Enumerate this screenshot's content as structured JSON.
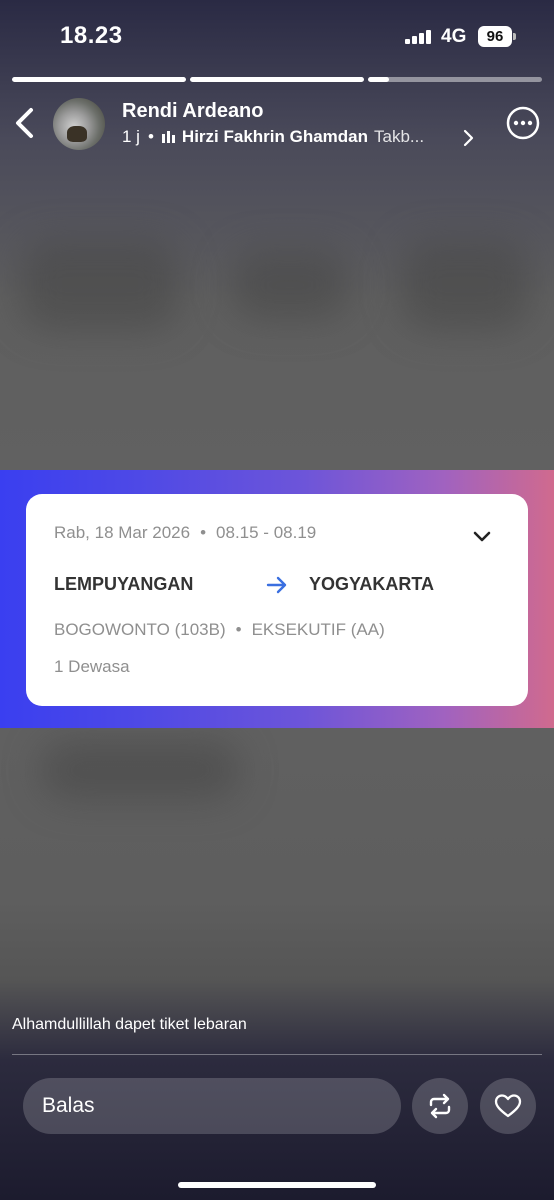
{
  "status_bar": {
    "time": "18.23",
    "network": "4G",
    "battery": "96"
  },
  "story_progress": [
    1.0,
    1.0,
    0.12
  ],
  "header": {
    "username": "Rendi Ardeano",
    "age": "1 j",
    "separator": "•",
    "song_artist": "Hirzi Fakhrin Ghamdan",
    "song_title_truncated": "Takb..."
  },
  "ticket": {
    "date": "Rab, 18 Mar 2026",
    "separator": "•",
    "time_range": "08.15 - 08.19",
    "origin": "LEMPUYANGAN",
    "destination": "YOGYAKARTA",
    "train": "BOGOWONTO (103B)",
    "class": "EKSEKUTIF (AA)",
    "passengers": "1 Dewasa"
  },
  "caption": "Alhamdullillah dapet tiket lebaran",
  "reply": {
    "placeholder": "Balas"
  },
  "colors": {
    "accent_arrow": "#3a6fe0",
    "band_left": "#3a3ff0",
    "band_right": "#d06a8e"
  },
  "icons": [
    "back-icon",
    "audio-bars-icon",
    "chevron-right-icon",
    "more-icon",
    "chevron-down-icon",
    "arrow-right-icon",
    "repost-icon",
    "heart-icon"
  ]
}
